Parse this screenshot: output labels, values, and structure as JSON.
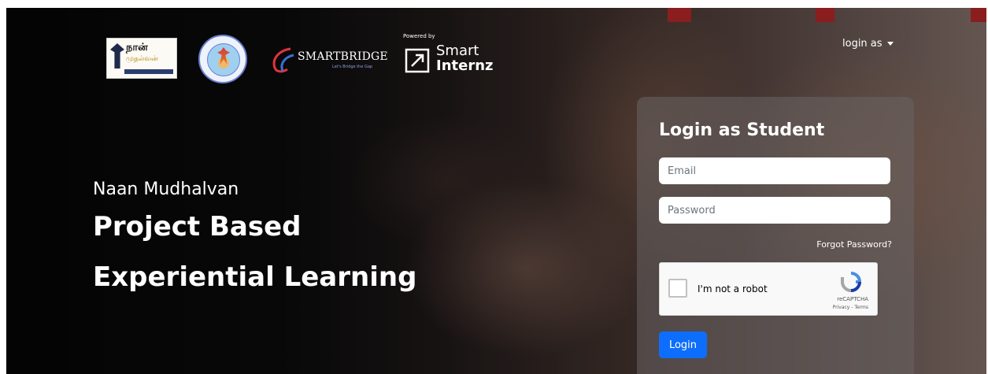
{
  "header": {
    "logos": {
      "naan_mudhalvan_tamil_line1": "நான்",
      "naan_mudhalvan_tamil_line2": "முதல்வன்",
      "smartbridge": "SMARTBRIDGE",
      "smartbridge_tagline": "Let's Bridge the Gap",
      "powered_by": "Powered by",
      "smart": "Smart",
      "internz": "Internz"
    },
    "login_as_label": "login as"
  },
  "hero": {
    "subtitle": "Naan Mudhalvan",
    "title_line1": "Project Based",
    "title_line2": "Experiential Learning"
  },
  "login_card": {
    "heading": "Login as Student",
    "email_placeholder": "Email",
    "password_placeholder": "Password",
    "forgot_password": "Forgot Password?",
    "recaptcha": {
      "label": "I'm not a robot",
      "brand": "reCAPTCHA",
      "links": "Privacy - Terms"
    },
    "login_button": "Login"
  },
  "colors": {
    "primary_button": "#0d6efd",
    "card_bg": "rgba(105,100,100,0.55)"
  }
}
